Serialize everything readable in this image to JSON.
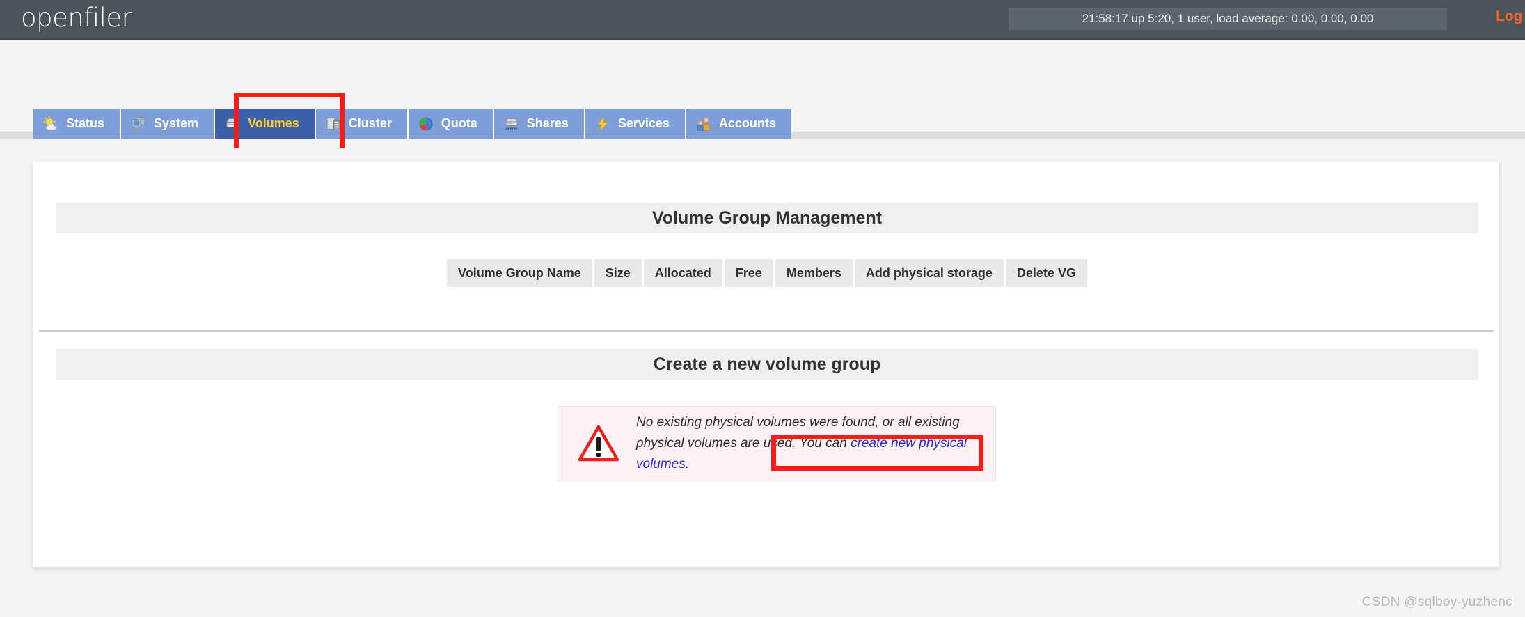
{
  "header": {
    "brand": "openfiler",
    "status": "21:58:17 up 5:20, 1 user, load average: 0.00, 0.00, 0.00",
    "logout_label": "Log out"
  },
  "tabs": [
    {
      "label": "Status",
      "icon": "weather-sun-cloud-icon",
      "active": false
    },
    {
      "label": "System",
      "icon": "monitor-icon",
      "active": false
    },
    {
      "label": "Volumes",
      "icon": "drive-green-arrow-icon",
      "active": true
    },
    {
      "label": "Cluster",
      "icon": "servers-stack-icon",
      "active": false
    },
    {
      "label": "Quota",
      "icon": "pie-chart-icon",
      "active": false
    },
    {
      "label": "Shares",
      "icon": "network-drive-icon",
      "active": false
    },
    {
      "label": "Services",
      "icon": "lightning-bolt-icon",
      "active": false
    },
    {
      "label": "Accounts",
      "icon": "users-group-icon",
      "active": false
    }
  ],
  "main": {
    "vg_section_title": "Volume Group Management",
    "vg_table_headers": [
      "Volume Group Name",
      "Size",
      "Allocated",
      "Free",
      "Members",
      "Add physical storage",
      "Delete VG"
    ],
    "create_section_title": "Create a new volume group",
    "warning": {
      "icon": "warning-triangle-icon",
      "text_before": "No existing physical volumes were found, or all existing physical volumes are used. You can ",
      "link_text": "create new physical volumes",
      "text_after": "."
    }
  },
  "annotations": [
    {
      "name": "volumes-tab-highlight",
      "color": "#fb1c19"
    },
    {
      "name": "create-physical-volumes-link-highlight",
      "color": "#fb1c19"
    }
  ],
  "watermark": "CSDN @sqlboy-yuzhenc"
}
